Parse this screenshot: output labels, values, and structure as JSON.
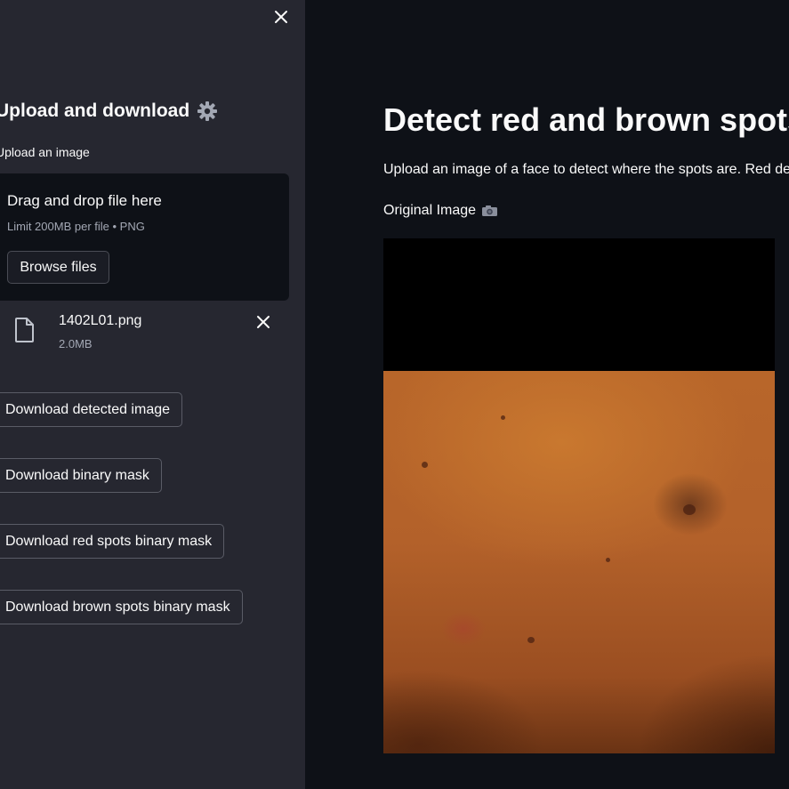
{
  "sidebar": {
    "heading": "Upload and download",
    "heading_icon": "gear-icon",
    "close_icon": "close-icon",
    "uploader": {
      "label": "Upload an image",
      "drop_title": "Drag and drop file here",
      "limit_text": "Limit 200MB per file • PNG",
      "browse_label": "Browse files"
    },
    "file": {
      "icon": "file-icon",
      "name": "1402L01.png",
      "size": "2.0MB",
      "remove_icon": "close-icon"
    },
    "downloads": [
      {
        "label": "Download detected image"
      },
      {
        "label": "Download binary mask"
      },
      {
        "label": "Download red spots binary mask"
      },
      {
        "label": "Download brown spots binary mask"
      }
    ]
  },
  "main": {
    "title": "Detect red and brown spots",
    "description": "Upload an image of a face to detect where the spots are. Red de",
    "image_caption": "Original Image",
    "caption_icon": "camera-icon"
  },
  "colors": {
    "sidebar_bg": "#262730",
    "main_bg": "#0e1117",
    "text": "#fafafa",
    "muted_text": "#a3a8b4"
  }
}
